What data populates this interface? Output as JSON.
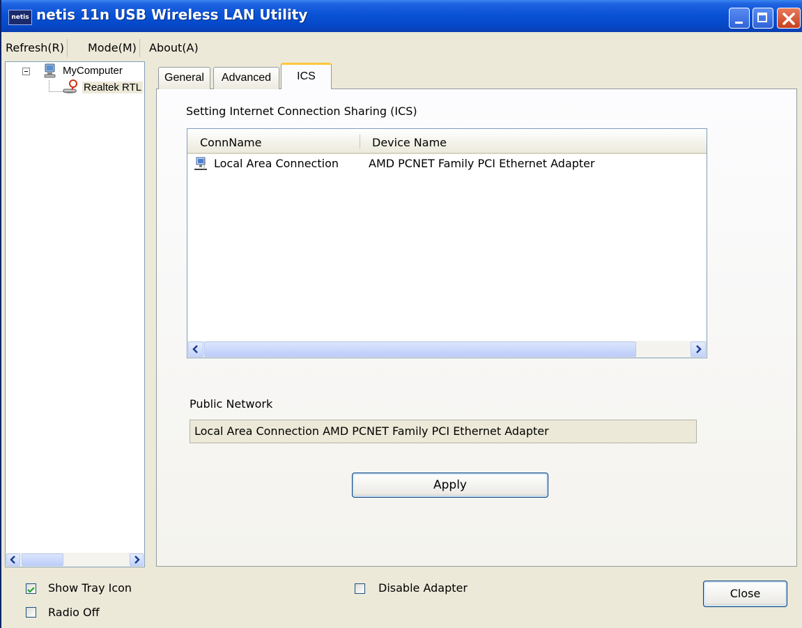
{
  "window": {
    "title": "netis 11n USB Wireless LAN Utility",
    "app_icon_text": "netis",
    "icons": [
      "minimize-icon",
      "maximize-icon",
      "close-icon"
    ]
  },
  "menu": {
    "items": [
      {
        "label": "Refresh(R)"
      },
      {
        "label": "Mode(M)"
      },
      {
        "label": "About(A)"
      }
    ]
  },
  "tree": {
    "root_label": "MyComputer",
    "child_label": "Realtek RTL",
    "icons": [
      "computer-icon",
      "wireless-adapter-icon"
    ]
  },
  "tabs": [
    {
      "label": "General"
    },
    {
      "label": "Advanced"
    },
    {
      "label": "ICS",
      "active": true
    }
  ],
  "ics": {
    "section_title": "Setting Internet Connection Sharing (ICS)",
    "columns": [
      "ConnName",
      "Device Name"
    ],
    "rows": [
      {
        "conn_name": "Local Area Connection",
        "device_name": "AMD PCNET Family PCI Ethernet Adapter",
        "icon": "network-connection-icon"
      }
    ],
    "public_network_label": "Public Network",
    "public_network_value": "Local Area Connection AMD PCNET Family PCI Ethernet Adapter",
    "apply_label": "Apply"
  },
  "bottom": {
    "show_tray_icon_label": "Show Tray Icon",
    "show_tray_icon_checked": true,
    "radio_off_label": "Radio Off",
    "radio_off_checked": false,
    "disable_adapter_label": "Disable Adapter",
    "disable_adapter_checked": false,
    "close_label": "Close"
  },
  "colors": {
    "titlebar": "#0a52d6",
    "face": "#ece9d8",
    "active_tab_accent": "#ffc83c"
  }
}
